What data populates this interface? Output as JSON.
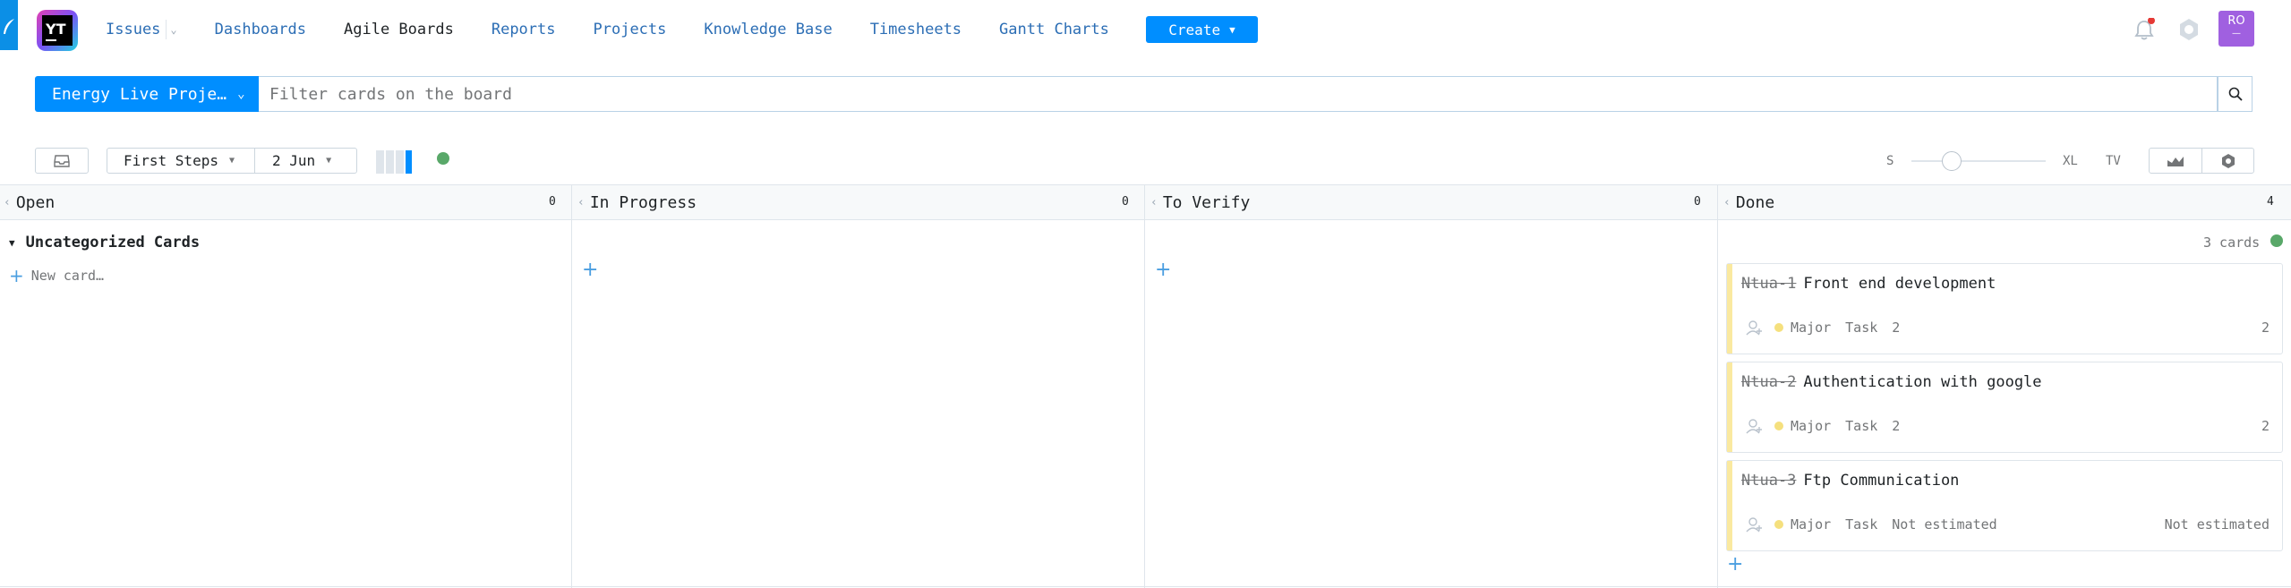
{
  "header": {
    "logo_text": "YT",
    "nav": [
      {
        "label": "Issues"
      },
      {
        "label": "Dashboards"
      },
      {
        "label": "Agile Boards"
      },
      {
        "label": "Reports"
      },
      {
        "label": "Projects"
      },
      {
        "label": "Knowledge Base"
      },
      {
        "label": "Timesheets"
      },
      {
        "label": "Gantt Charts"
      }
    ],
    "create_label": "Create",
    "avatar_initials": "RO",
    "avatar_sub": "—",
    "notification_color": "#e53935"
  },
  "search": {
    "project_label": "Energy Live Proje…",
    "placeholder": "Filter cards on the board"
  },
  "toolbar": {
    "board_label": "First Steps",
    "sprint_label": "2 Jun",
    "size_small": "S",
    "size_large": "XL",
    "tv_label": "TV",
    "size_level": 0.3
  },
  "columns": [
    {
      "name": "Open",
      "count": "0"
    },
    {
      "name": "In Progress",
      "count": "0"
    },
    {
      "name": "To Verify",
      "count": "0"
    },
    {
      "name": "Done",
      "count": "4"
    }
  ],
  "swimlane": {
    "title": "Uncategorized Cards",
    "count": "3 cards",
    "new_card": "New card…"
  },
  "cards": [
    {
      "id": "Ntua-1",
      "title": "Front end development",
      "priority": "Major",
      "type": "Task",
      "estimate": "2",
      "spent": "2"
    },
    {
      "id": "Ntua-2",
      "title": "Authentication with google",
      "priority": "Major",
      "type": "Task",
      "estimate": "2",
      "spent": "2"
    },
    {
      "id": "Ntua-3",
      "title": "Ftp Communication",
      "priority": "Major",
      "type": "Task",
      "estimate": "Not estimated",
      "spent": "Not estimated"
    }
  ],
  "colors": {
    "accent": "#008eff",
    "priority_major": "#f5e07e",
    "card_stripe": "#fae9a0",
    "status_green": "#59a869"
  }
}
